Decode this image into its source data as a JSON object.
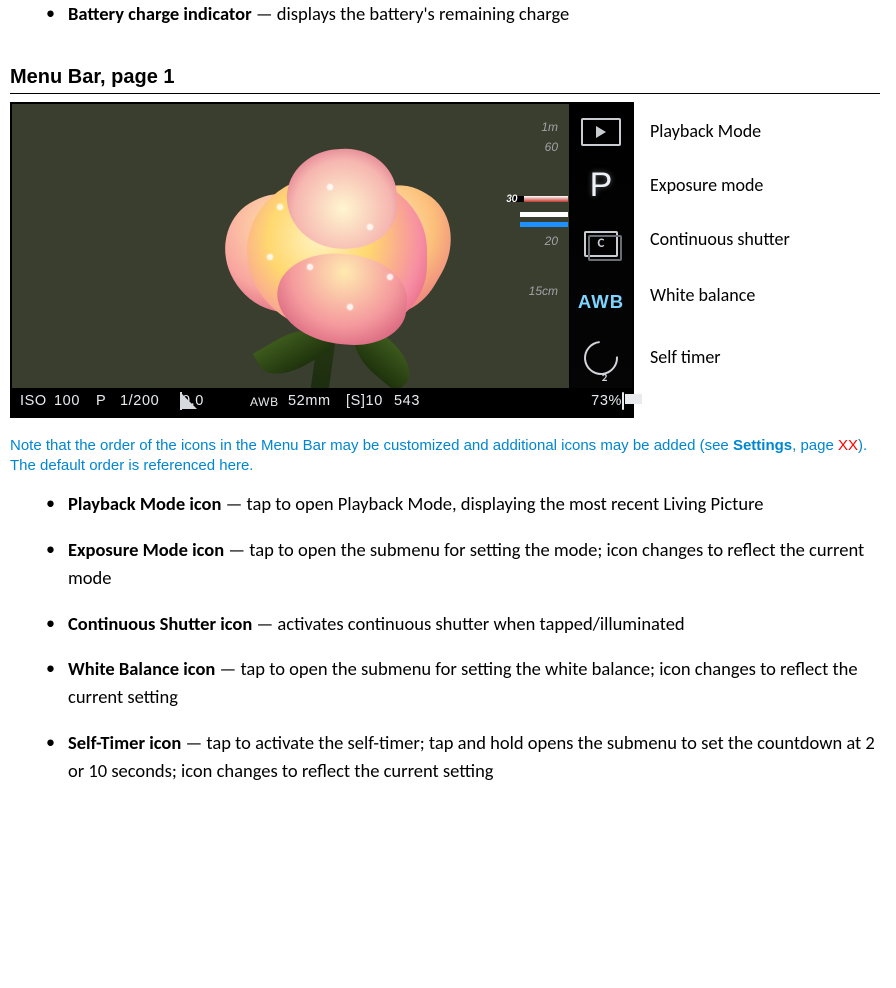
{
  "top_bullet": {
    "term": "Battery charge indicator",
    "desc": " — displays the battery's remaining charge"
  },
  "heading": "Menu Bar, page 1",
  "vscale": {
    "l1": "1m",
    "l2": "60",
    "l3": "20",
    "l4": "15cm"
  },
  "menu": {
    "p_letter": "P",
    "c_letter": "C",
    "awb": "AWB",
    "labels": {
      "play": "Playback Mode",
      "exposure": "Exposure mode",
      "cont": "Continuous shutter",
      "wb": "White balance",
      "timer": "Self timer"
    }
  },
  "status": {
    "iso_label": "ISO",
    "iso_value": "100",
    "mode": "P",
    "shutter": "1/200",
    "ev": "0.0",
    "awb": "AWB",
    "focal": "52mm",
    "s10": "[S]10",
    "count": "543",
    "batt_pct": "73%"
  },
  "note": {
    "t1": "Note that the order of the icons in the Menu Bar may be customized and additional icons may be added (see ",
    "settings": "Settings",
    "t2": ", page ",
    "xx": "XX",
    "t3": "). The default order is referenced here."
  },
  "bullets": [
    {
      "term": "Playback Mode icon",
      "desc": " — tap to open Playback Mode, displaying the most recent Living Picture"
    },
    {
      "term": "Exposure Mode icon",
      "desc": " — tap to open the submenu for setting the mode; icon changes to reflect the current mode"
    },
    {
      "term": "Continuous Shutter icon",
      "desc": " — activates continuous shutter when tapped/illuminated"
    },
    {
      "term": "White Balance icon",
      "desc": " — tap to open the submenu for setting the white balance; icon changes to reflect the current setting"
    },
    {
      "term": "Self-Timer icon",
      "desc": " — tap to activate the self-timer; tap and hold opens the submenu to set the countdown at 2 or 10 seconds; icon changes to reflect the current setting"
    }
  ]
}
